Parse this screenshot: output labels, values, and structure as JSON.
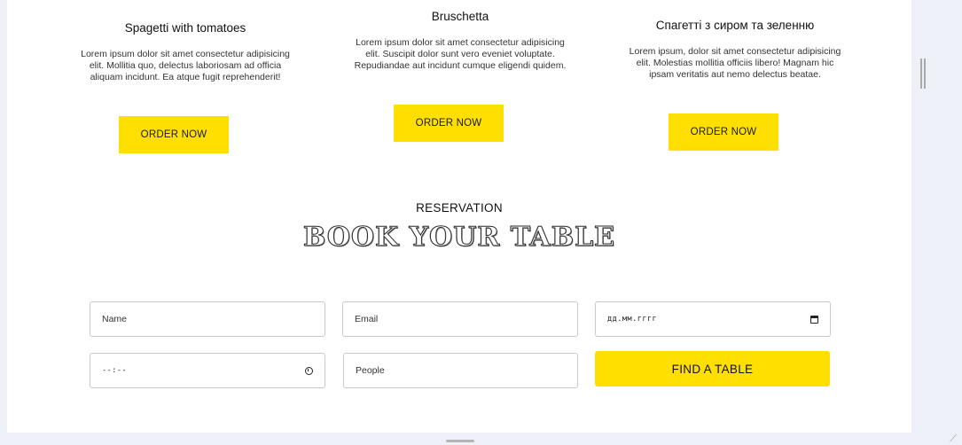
{
  "dishes": [
    {
      "title": "Spagetti with tomatoes",
      "description": "Lorem ipsum dolor sit amet consectetur adipisicing elit. Mollitia quo, delectus laboriosam ad officia aliquam incidunt. Ea atque fugit reprehenderit!",
      "button_label": "ORDER NOW"
    },
    {
      "title": "Bruschetta",
      "description": "Lorem ipsum dolor sit amet consectetur adipisicing elit. Suscipit dolor sunt vero eveniet voluptate. Repudiandae aut incidunt cumque eligendi quidem.",
      "button_label": "ORDER NOW"
    },
    {
      "title": "Спагетті з сиром та зеленню",
      "description": "Lorem ipsum, dolor sit amet consectetur adipisicing elit. Molestias mollitia officiis libero! Magnam hic ipsam veritatis aut nemo delectus beatae.",
      "button_label": "ORDER NOW"
    }
  ],
  "reservation": {
    "label": "RESERVATION",
    "heading": "BOOK YOUR TABLE",
    "form": {
      "name_placeholder": "Name",
      "email_placeholder": "Email",
      "date_placeholder": "дд.мм.гггг",
      "time_placeholder": "--:--",
      "people_placeholder": "People",
      "submit_label": "FIND A TABLE"
    }
  },
  "colors": {
    "accent": "#ffdf00",
    "background": "#ffffff",
    "frame": "#eef0f7"
  },
  "icons": {
    "date": "calendar-icon",
    "time": "clock-icon"
  }
}
